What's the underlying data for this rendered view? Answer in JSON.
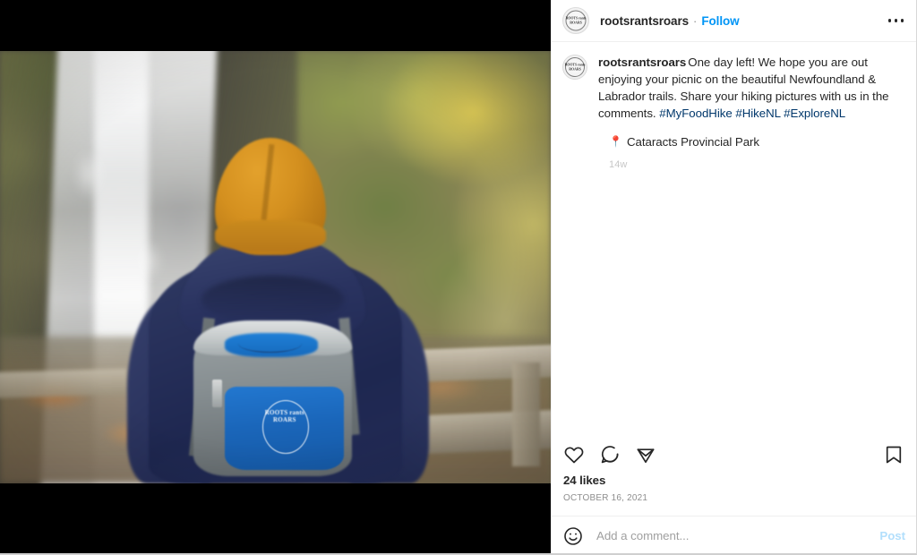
{
  "post": {
    "header": {
      "username": "rootsrantsroars",
      "separator": "·",
      "follow_label": "Follow",
      "avatar_mark": "ROOTS rants ROARS",
      "more_options_label": "More options"
    },
    "caption": {
      "username": "rootsrantsroars",
      "text": "One day left! We hope you are out enjoying your picnic on the beautiful Newfoundland & Labrador trails. Share your hiking pictures with us in the comments. ",
      "hashtags": [
        "#MyFoodHike",
        "#HikeNL",
        "#ExploreNL"
      ],
      "hashtag_1": "#MyFoodHike",
      "hashtag_2": "#HikeNL",
      "hashtag_3": "#ExploreNL",
      "location_pin": "📍",
      "location": "Cataracts Provincial Park",
      "age": "14w"
    },
    "actions": {
      "like_label": "Like",
      "comment_label": "Comment",
      "share_label": "Share",
      "save_label": "Save"
    },
    "likes": "24 likes",
    "date": "OCTOBER 16, 2021",
    "comment_box": {
      "emoji_label": "Emoji",
      "placeholder": "Add a comment...",
      "value": "",
      "post_label": "Post"
    },
    "media": {
      "alt": "Person in an orange beanie and navy jacket wearing a Roots Rants Roars cooler backpack, looking at a waterfall",
      "backpack_logo": "ROOTS rants ROARS"
    }
  },
  "colors": {
    "link_blue": "#0095f6",
    "hashtag_blue": "#00376b",
    "text_primary": "#262626",
    "text_muted": "#8e8e8e",
    "border": "#efefef",
    "post_disabled": "#b2dffc"
  }
}
